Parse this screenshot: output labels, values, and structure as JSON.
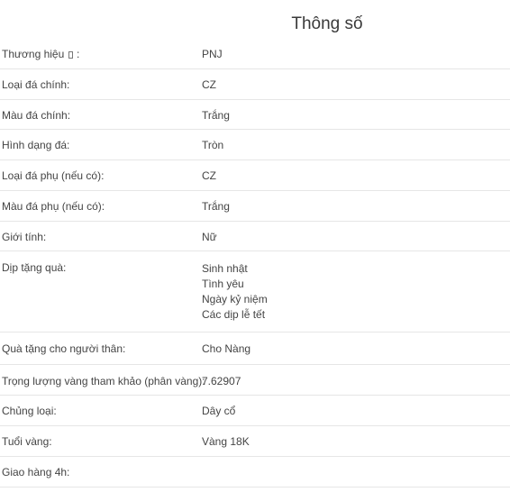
{
  "title": "Thông số",
  "rows": [
    {
      "label": "Thương hiệu",
      "label_suffix": " :",
      "value": "PNJ"
    },
    {
      "label": "Loại đá chính:",
      "value": "CZ"
    },
    {
      "label": "Màu đá chính:",
      "value": "Trắng"
    },
    {
      "label": "Hình dạng đá:",
      "value": "Tròn"
    },
    {
      "label": "Loại đá phụ (nếu có):",
      "value": "CZ"
    },
    {
      "label": "Màu đá phụ (nếu có):",
      "value": "Trắng"
    },
    {
      "label": "Giới tính:",
      "value": "Nữ"
    },
    {
      "label": "Dịp tặng quà:",
      "values": [
        "Sinh nhật",
        "Tình yêu",
        "Ngày kỷ niệm",
        "Các dịp lễ tết"
      ]
    },
    {
      "label": "Quà tặng cho người thân:",
      "value": "Cho Nàng"
    },
    {
      "label": "Trọng lượng vàng tham khảo (phân vàng):",
      "value": "7.62907"
    },
    {
      "label": "Chủng loại:",
      "value": "Dây cổ"
    },
    {
      "label": "Tuổi vàng:",
      "value": "Vàng 18K"
    },
    {
      "label": "Giao hàng 4h:",
      "value": ""
    }
  ]
}
